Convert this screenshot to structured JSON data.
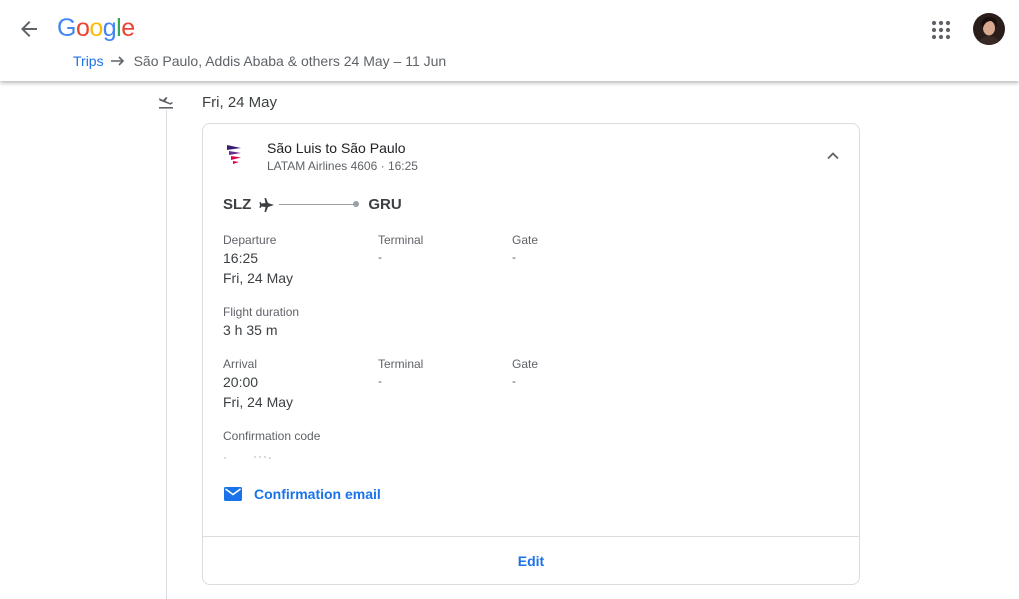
{
  "header": {
    "logo_letters": [
      {
        "ch": "G",
        "color": "#4285F4"
      },
      {
        "ch": "o",
        "color": "#EA4335"
      },
      {
        "ch": "o",
        "color": "#FBBC05"
      },
      {
        "ch": "g",
        "color": "#4285F4"
      },
      {
        "ch": "l",
        "color": "#34A853"
      },
      {
        "ch": "e",
        "color": "#EA4335"
      }
    ],
    "breadcrumb_link": "Trips",
    "breadcrumb_current": "São Paulo, Addis Ababa & others 24 May – 11 Jun"
  },
  "day": {
    "heading": "Fri, 24 May"
  },
  "flight": {
    "title": "São Luis to São Paulo",
    "subtitle": "LATAM Airlines 4606 · 16:25",
    "origin": "SLZ",
    "destination": "GRU",
    "departure": {
      "label": "Departure",
      "time": "16:25",
      "date": "Fri, 24 May",
      "terminal_label": "Terminal",
      "terminal_value": "-",
      "gate_label": "Gate",
      "gate_value": "-"
    },
    "duration": {
      "label": "Flight duration",
      "value": "3 h 35 m"
    },
    "arrival": {
      "label": "Arrival",
      "time": "20:00",
      "date": "Fri, 24 May",
      "terminal_label": "Terminal",
      "terminal_value": "-",
      "gate_label": "Gate",
      "gate_value": "-"
    },
    "confirmation_label": "Confirmation code",
    "confirmation_email": "Confirmation email",
    "edit_label": "Edit"
  },
  "colors": {
    "accent": "#1a73e8",
    "latam_purple": "#3b1e73",
    "latam_red": "#e3004f"
  }
}
